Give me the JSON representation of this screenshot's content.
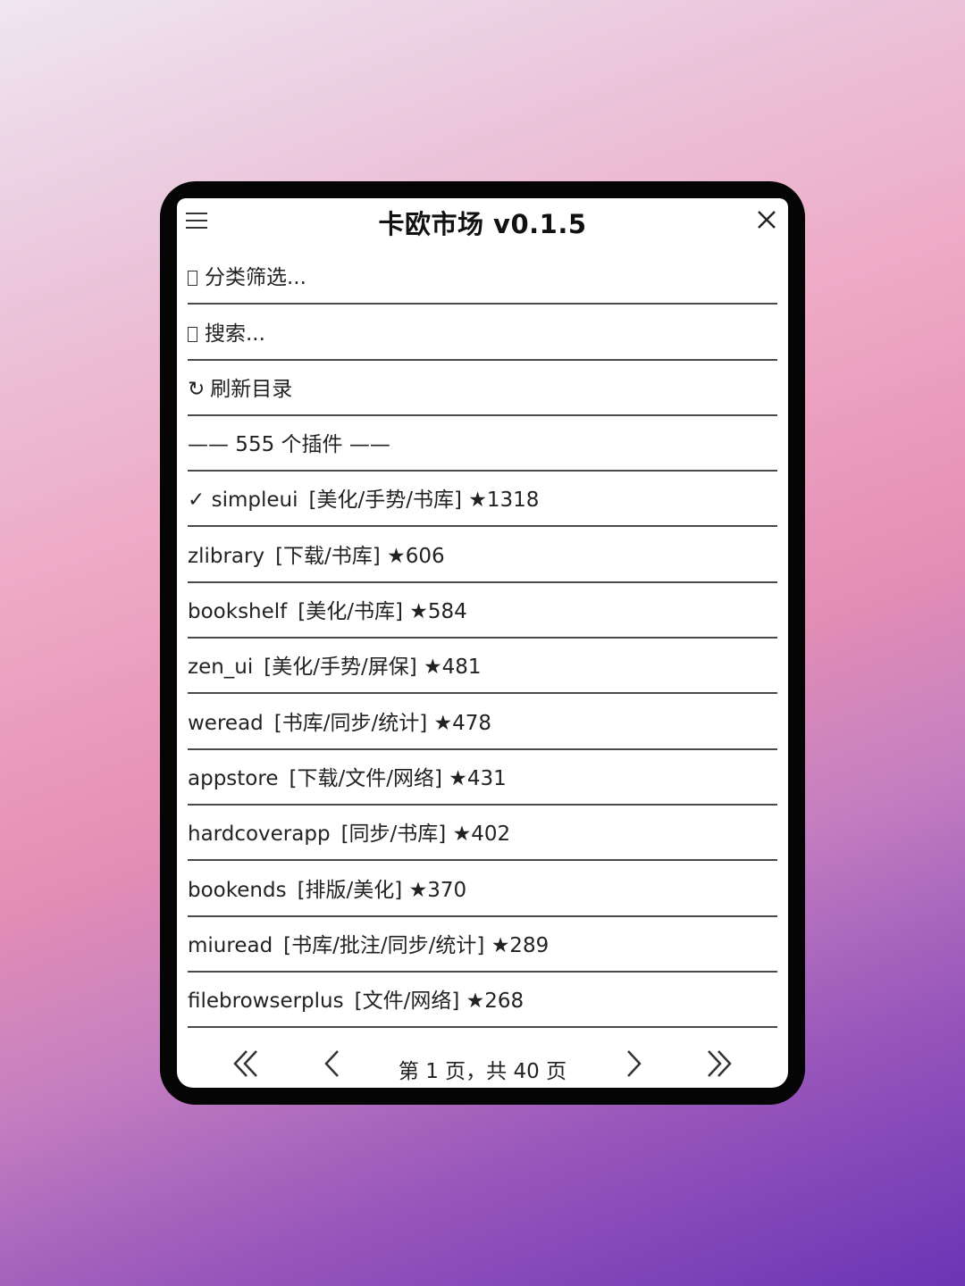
{
  "app": {
    "title": "卡欧市场  v0.1.5"
  },
  "icons": {
    "menu": "hamburger-menu-icon",
    "close": "close-icon",
    "filter": "missing-glyph-box",
    "search": "missing-glyph-box",
    "refresh": "refresh-icon",
    "first_page": "double-chevron-left-icon",
    "prev_page": "chevron-left-icon",
    "next_page": "chevron-right-icon",
    "last_page": "double-chevron-right-icon"
  },
  "actions": {
    "filter_label": "分类筛选...",
    "search_label": "搜索...",
    "refresh_label": "刷新目录",
    "refresh_glyph": "↻"
  },
  "plugin_count_label": "—— 555 个插件 ——",
  "plugins": [
    {
      "prefix": "✓ ",
      "name": "simpleui",
      "tags": "[美化/手势/书库]",
      "stars": "★1318"
    },
    {
      "prefix": "",
      "name": "zlibrary",
      "tags": "[下载/书库]",
      "stars": "★606"
    },
    {
      "prefix": "",
      "name": "bookshelf",
      "tags": "[美化/书库]",
      "stars": "★584"
    },
    {
      "prefix": "",
      "name": "zen_ui",
      "tags": "[美化/手势/屏保]",
      "stars": "★481"
    },
    {
      "prefix": "",
      "name": "weread",
      "tags": "[书库/同步/统计]",
      "stars": "★478"
    },
    {
      "prefix": "",
      "name": "appstore",
      "tags": "[下载/文件/网络]",
      "stars": "★431"
    },
    {
      "prefix": "",
      "name": "hardcoverapp",
      "tags": "[同步/书库]",
      "stars": "★402"
    },
    {
      "prefix": "",
      "name": "bookends",
      "tags": "[排版/美化]",
      "stars": "★370"
    },
    {
      "prefix": "",
      "name": "miuread",
      "tags": "[书库/批注/同步/统计]",
      "stars": "★289"
    },
    {
      "prefix": "",
      "name": "filebrowserplus",
      "tags": "[文件/网络]",
      "stars": "★268"
    }
  ],
  "pager": {
    "label": "第 1 页，共 40 页"
  }
}
